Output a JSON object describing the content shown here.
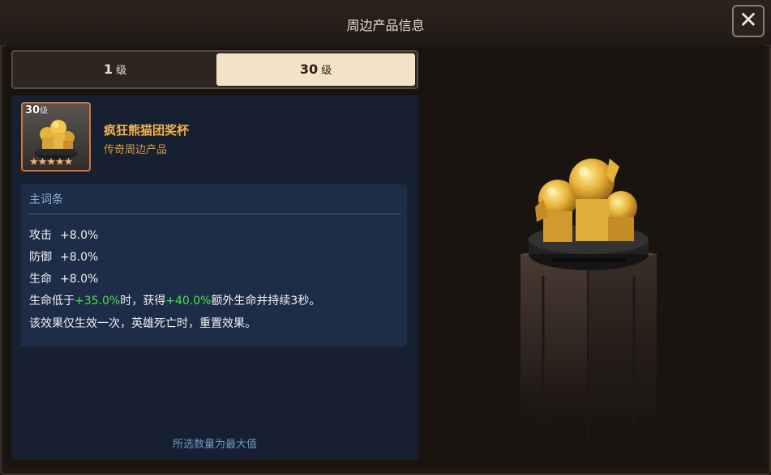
{
  "window": {
    "title": "周边产品信息",
    "close_icon": "close-icon"
  },
  "tabs": [
    {
      "level": "1",
      "unit": "级",
      "selected": false
    },
    {
      "level": "30",
      "unit": "级",
      "selected": true
    }
  ],
  "item": {
    "level": "30",
    "level_unit": "级",
    "stars": "★★★★★",
    "star_count": 5,
    "name": "疯狂熊猫团奖杯",
    "rarity": "传奇周边产品"
  },
  "stats": {
    "header": "主词条",
    "rows": [
      {
        "label": "攻击",
        "value": "+8.0%"
      },
      {
        "label": "防御",
        "value": "+8.0%"
      },
      {
        "label": "生命",
        "value": "+8.0%"
      }
    ],
    "effect": {
      "p1": "生命低于",
      "v1": "+35.0%",
      "p2": "时，获得",
      "v2": "+40.0%",
      "p3": "额外生命并持续3秒。",
      "line2": "该效果仅生效一次，英雄死亡时，重置效果。"
    }
  },
  "footer_note": "所选数量为最大值",
  "colors": {
    "accent_gold": "#f4b24d",
    "highlight_green": "#4fe04a",
    "selected_tab": "#f3e2c8"
  }
}
